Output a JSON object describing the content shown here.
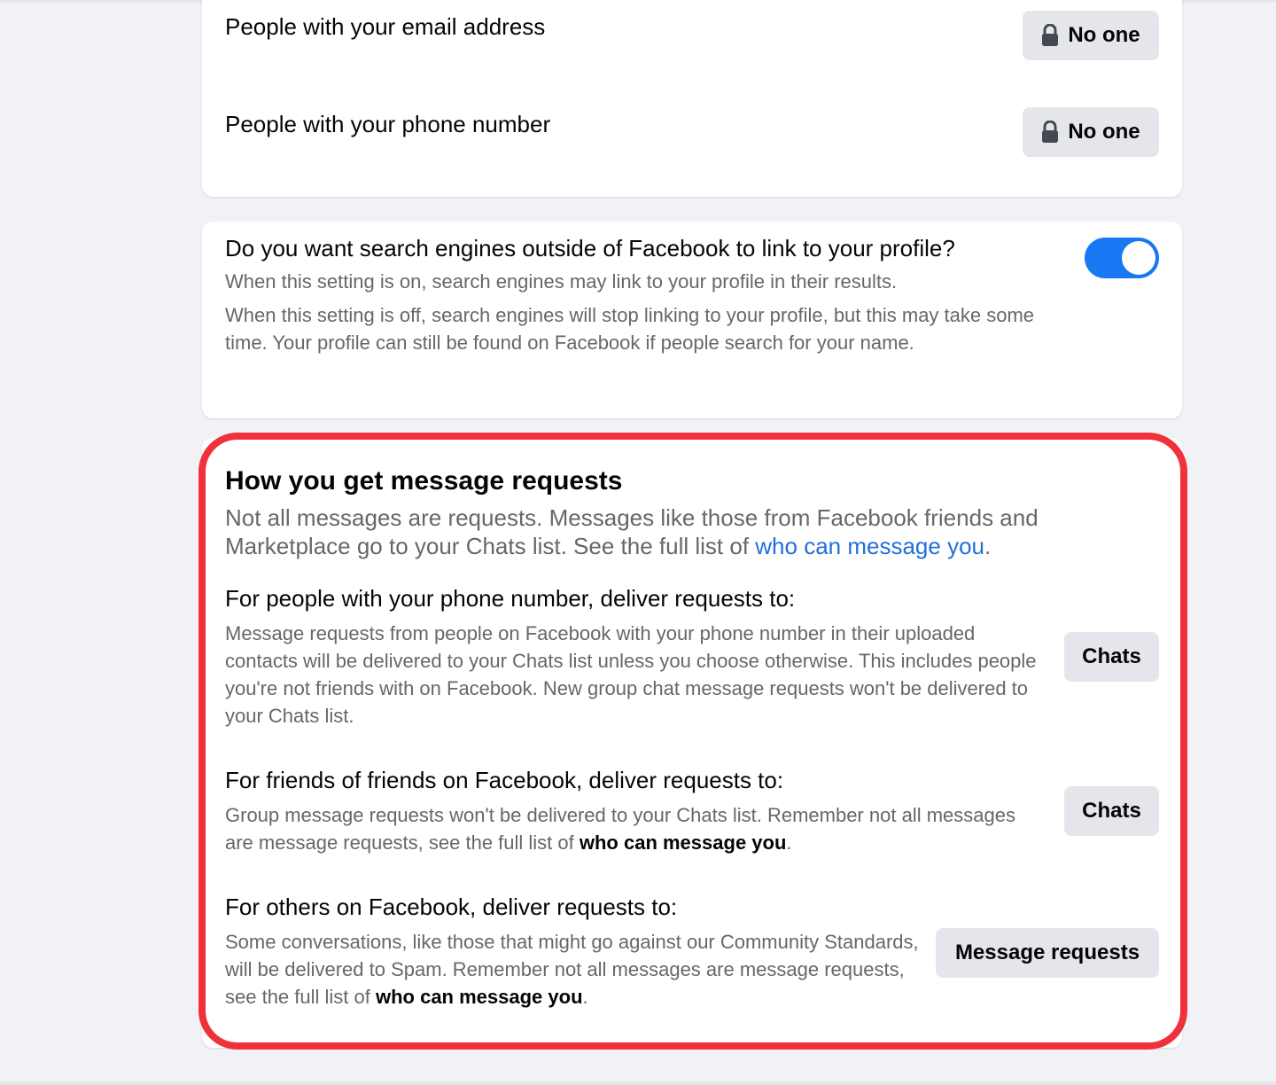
{
  "contact_card": {
    "email_label": "People with your email address",
    "email_value": "No one",
    "phone_label": "People with your phone number",
    "phone_value": "No one"
  },
  "search_card": {
    "question": "Do you want search engines outside of Facebook to link to your profile?",
    "on_text": "When this setting is on, search engines may link to your profile in their results.",
    "off_text": "When this setting is off, search engines will stop linking to your profile, but this may take some time. Your profile can still be found on Facebook if people search for your name.",
    "toggle_on": true
  },
  "requests_card": {
    "heading": "How you get message requests",
    "intro_text": "Not all messages are requests. Messages like those from Facebook friends and Marketplace go to your Chats list. See the full list of ",
    "intro_link": "who can message you",
    "intro_end": ".",
    "phone": {
      "title": "For people with your phone number, deliver requests to:",
      "desc": "Message requests from people on Facebook with your phone number in their uploaded contacts will be delivered to your Chats list unless you choose otherwise. This includes people you're not friends with on Facebook. New group chat message requests won't be delivered to your Chats list.",
      "button": "Chats"
    },
    "fof": {
      "title": "For friends of friends on Facebook, deliver requests to:",
      "desc": "Group message requests won't be delivered to your Chats list. Remember not all messages are message requests, see the full list of ",
      "desc_link": "who can message you",
      "desc_end": ".",
      "button": "Chats"
    },
    "others": {
      "title": "For others on Facebook, deliver requests to:",
      "desc": "Some conversations, like those that might go against our Community Standards, will be delivered to Spam. Remember not all messages are message requests, see the full list of ",
      "desc_link": "who can message you",
      "desc_end": ".",
      "button": "Message requests"
    }
  },
  "icons": {
    "lock": "lock-icon"
  },
  "colors": {
    "accent": "#1877f2",
    "link": "#216fdb",
    "highlight": "#f0313b",
    "button_bg": "#e4e6eb",
    "secondary_text": "#65676b"
  }
}
